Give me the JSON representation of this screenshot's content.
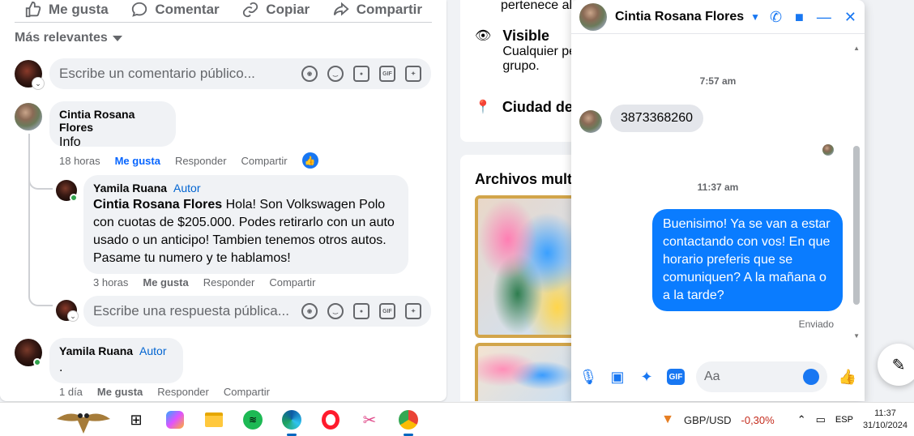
{
  "post_actions": {
    "like": "Me gusta",
    "comment": "Comentar",
    "copy": "Copiar",
    "share": "Compartir"
  },
  "sort": {
    "label": "Más relevantes"
  },
  "comment_box": {
    "placeholder": "Escribe un comentario público..."
  },
  "comments": [
    {
      "name": "Cintia Rosana Flores",
      "text": "Info",
      "time": "18 horas",
      "like": "Me gusta",
      "reply": "Responder",
      "share": "Compartir"
    },
    {
      "name": "Yamila Ruana",
      "author_badge": "Autor",
      "mention": "Cintia Rosana Flores",
      "text": "Hola! Son Volkswagen Polo con cuotas de $205.000. Podes retirarlo con un auto usado o un anticipo! Tambien tenemos otros autos. Pasame tu numero y te hablamos!",
      "time": "3 horas",
      "like": "Me gusta",
      "reply": "Responder",
      "share": "Compartir"
    },
    {
      "name": "Yamila Ruana",
      "author_badge": "Autor",
      "text": ".",
      "time": "1 día",
      "like": "Me gusta",
      "reply": "Responder",
      "share": "Compartir"
    }
  ],
  "reply_box": {
    "placeholder": "Escribe una respuesta pública..."
  },
  "about": {
    "line1": "pertenece al",
    "visible_title": "Visible",
    "visible_text_1": "Cualquier pe",
    "visible_text_2": "grupo.",
    "city_title": "Ciudad de",
    "media_title": "Archivos multi"
  },
  "chat": {
    "contact_name": "Cintia Rosana Flores",
    "time1": "7:57 am",
    "incoming": "3873368260",
    "time2": "11:37 am",
    "outgoing": "Buenisimo! Ya se van a estar contactando con vos! En que horario preferis que se comuniquen? A la mañana o a la tarde?",
    "status": "Enviado",
    "input_placeholder": "Aa"
  },
  "taskbar": {
    "ticker_name": "GBP/USD",
    "ticker_value": "-0,30%",
    "language": "ESP",
    "time": "11:37",
    "date": "31/10/2024"
  },
  "colors": {
    "accent": "#1877f2",
    "outgoing_bubble": "#0a7cff",
    "negative": "#c42b1c"
  }
}
